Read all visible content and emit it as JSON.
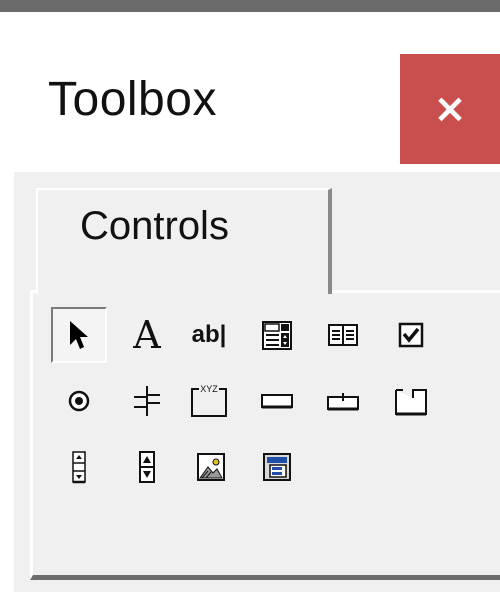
{
  "window": {
    "title": "Toolbox",
    "close_label": "×"
  },
  "tabs": [
    {
      "label": "Controls",
      "active": true
    }
  ],
  "tools": [
    {
      "name": "select-objects",
      "icon": "pointer-icon",
      "selected": true
    },
    {
      "name": "label",
      "icon": "label-icon",
      "glyph": "A"
    },
    {
      "name": "textbox",
      "icon": "textbox-icon",
      "glyph": "ab|"
    },
    {
      "name": "combobox",
      "icon": "combobox-icon"
    },
    {
      "name": "listbox",
      "icon": "listbox-icon"
    },
    {
      "name": "checkbox",
      "icon": "checkbox-icon"
    },
    {
      "name": "optionbutton",
      "icon": "optionbutton-icon"
    },
    {
      "name": "togglebutton",
      "icon": "togglebutton-icon"
    },
    {
      "name": "frame",
      "icon": "frame-icon",
      "glyph": "XYZ"
    },
    {
      "name": "commandbutton",
      "icon": "commandbutton-icon"
    },
    {
      "name": "tabstrip",
      "icon": "tabstrip-icon"
    },
    {
      "name": "multipage",
      "icon": "multipage-icon"
    },
    {
      "name": "scrollbar",
      "icon": "scrollbar-icon"
    },
    {
      "name": "spinbutton",
      "icon": "spinbutton-icon"
    },
    {
      "name": "image",
      "icon": "image-icon"
    },
    {
      "name": "refedit",
      "icon": "refedit-icon"
    }
  ],
  "colors": {
    "close_button": "#c94f4f",
    "window_bg": "#f0f0f0",
    "refedit_blue": "#1f4fa8"
  }
}
